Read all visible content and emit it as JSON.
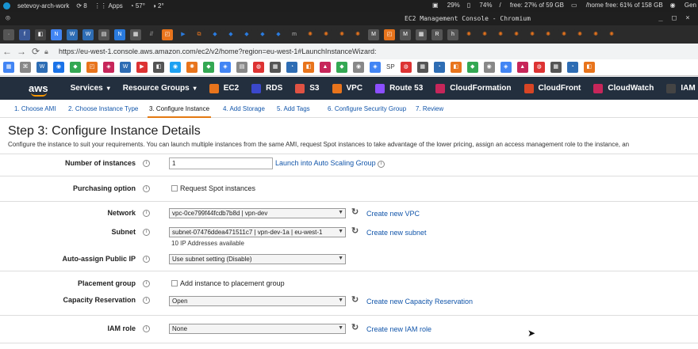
{
  "system_bar": {
    "hostname": "setevoy-arch-work",
    "updates": "8",
    "apps": "Apps",
    "temp": "57°",
    "volume": "2°",
    "cpu": "29%",
    "battery": "74%",
    "disk_free": "free: 27% of 59 GB",
    "home_free": "/home free: 61% of 158 GB",
    "network": "Gen"
  },
  "window": {
    "title": "EC2 Management Console - Chromium"
  },
  "browser": {
    "url": "https://eu-west-1.console.aws.amazon.com/ec2/v2/home?region=eu-west-1#LaunchInstanceWizard:",
    "bookmark_text": "SP"
  },
  "aws_nav": {
    "logo": "aws",
    "services": "Services",
    "resource_groups": "Resource Groups",
    "items": [
      {
        "label": "EC2",
        "color": "#e8741c"
      },
      {
        "label": "RDS",
        "color": "#3b48cc"
      },
      {
        "label": "S3",
        "color": "#e05243"
      },
      {
        "label": "VPC",
        "color": "#e8741c"
      },
      {
        "label": "Route 53",
        "color": "#8c4fff"
      },
      {
        "label": "CloudFormation",
        "color": "#c7265a"
      },
      {
        "label": "CloudFront",
        "color": "#d84525"
      },
      {
        "label": "CloudWatch",
        "color": "#c7265a"
      },
      {
        "label": "IAM",
        "color": "#444"
      }
    ]
  },
  "steps": [
    "1. Choose AMI",
    "2. Choose Instance Type",
    "3. Configure Instance",
    "4. Add Storage",
    "5. Add Tags",
    "6. Configure Security Group",
    "7. Review"
  ],
  "active_step": 2,
  "page": {
    "title": "Step 3: Configure Instance Details",
    "description": "Configure the instance to suit your requirements. You can launch multiple instances from the same AMI, request Spot instances to take advantage of the lower pricing, assign an access management role to the instance, an"
  },
  "form": {
    "number_of_instances": {
      "label": "Number of instances",
      "value": "1",
      "link": "Launch into Auto Scaling Group"
    },
    "purchasing_option": {
      "label": "Purchasing option",
      "checkbox": "Request Spot instances"
    },
    "network": {
      "label": "Network",
      "value": "vpc-0ce799f44fcdb7b8d | vpn-dev",
      "link": "Create new VPC"
    },
    "subnet": {
      "label": "Subnet",
      "value": "subnet-07476ddea471511c7 | vpn-dev-1a | eu-west-1",
      "note": "10 IP Addresses available",
      "link": "Create new subnet"
    },
    "auto_assign": {
      "label": "Auto-assign Public IP",
      "value": "Use subnet setting (Disable)"
    },
    "placement_group": {
      "label": "Placement group",
      "checkbox": "Add instance to placement group"
    },
    "capacity_reservation": {
      "label": "Capacity Reservation",
      "value": "Open",
      "link": "Create new Capacity Reservation"
    },
    "iam_role": {
      "label": "IAM role",
      "value": "None",
      "link": "Create new IAM role"
    }
  }
}
